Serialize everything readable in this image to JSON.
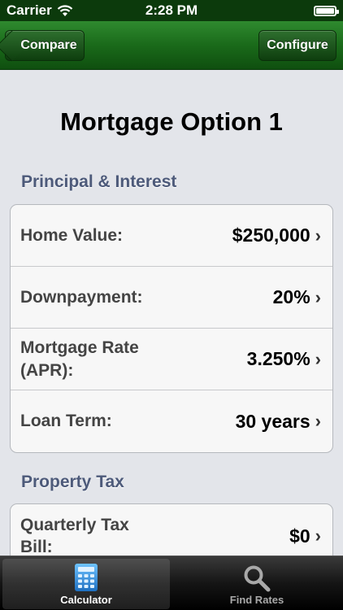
{
  "status_bar": {
    "carrier": "Carrier",
    "time": "2:28 PM"
  },
  "nav": {
    "back_label": "Compare",
    "configure_label": "Configure"
  },
  "page": {
    "title": "Mortgage Option 1"
  },
  "sections": [
    {
      "header": "Principal & Interest",
      "rows": [
        {
          "label": "Home Value:",
          "value": "$250,000"
        },
        {
          "label": "Downpayment:",
          "value": "20%"
        },
        {
          "label": "Mortgage Rate (APR):",
          "value": "3.250%"
        },
        {
          "label": "Loan Term:",
          "value": "30 years"
        }
      ]
    },
    {
      "header": "Property Tax",
      "rows": [
        {
          "label": "Quarterly Tax Bill:",
          "value": "$0"
        }
      ]
    }
  ],
  "tabs": [
    {
      "label": "Calculator",
      "icon": "calculator-icon",
      "active": true
    },
    {
      "label": "Find Rates",
      "icon": "magnifier-icon",
      "active": false
    }
  ],
  "colors": {
    "nav_green": "#1a6a1a",
    "section_header": "#4d5a7a",
    "calculator_blue": "#2f8ad6"
  }
}
